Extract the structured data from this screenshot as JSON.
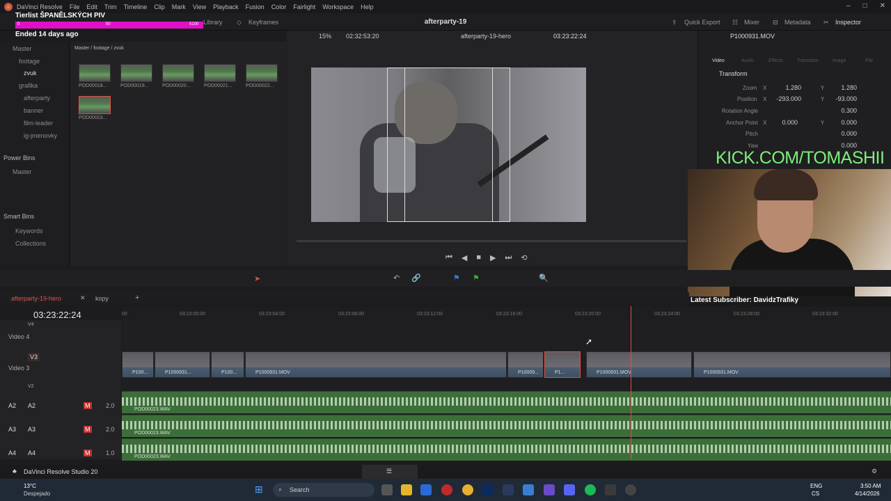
{
  "menu": {
    "app": "DaVinci Resolve",
    "items": [
      "File",
      "Edit",
      "Trim",
      "Timeline",
      "Clip",
      "Mark",
      "View",
      "Playback",
      "Fusion",
      "Color",
      "Fairlight",
      "Workspace",
      "Help"
    ]
  },
  "overlay": {
    "tierlist": "Tierlist ŠPANĚLSKÝCH PIV",
    "bar_left": "0",
    "bar_mid": "50",
    "bar_right": "5100",
    "ended": "Ended 14 days ago"
  },
  "toolbar": {
    "library": "Library",
    "keyframes": "Keyframes",
    "project_title": "afterparty-19",
    "quick_export": "Quick Export",
    "mixer": "Mixer",
    "metadata": "Metadata",
    "inspector": "Inspector"
  },
  "viewer": {
    "zoom": "15%",
    "timecode_left": "02:32:53:20",
    "timeline_name": "afterparty-19-hero",
    "timecode_right": "03:23:22:24"
  },
  "media": {
    "path": "Master / footage / zvuk",
    "thumbs": [
      "POD00018...",
      "POD00019...",
      "POD00020...",
      "POD00021...",
      "POD00022...",
      "POD00023..."
    ]
  },
  "bins": {
    "master": "Master",
    "footage": "footage",
    "zvuk": "zvuk",
    "grafika": "grafika",
    "afterparty": "afterparty",
    "banner": "banner",
    "film_leader": "film-leader",
    "ig": "ig-jmenovky",
    "power_bins": "Power Bins",
    "pb_master": "Master",
    "smart_bins": "Smart Bins",
    "keywords": "Keywords",
    "collections": "Collections"
  },
  "inspector": {
    "clip": "P1000931.MOV",
    "tab_video": "Video",
    "tab_audio": "Audio",
    "tab_effects": "Effects",
    "tab_transition": "Transition",
    "tab_image": "Image",
    "tab_file": "File",
    "transform": "Transform",
    "zoom_label": "Zoom",
    "zoom_x": "1.280",
    "zoom_y": "1.280",
    "position_label": "Position",
    "pos_x": "-293.000",
    "pos_y": "-93.000",
    "rotation_label": "Rotation Angle",
    "rotation": "0.300",
    "anchor_label": "Anchor Point",
    "anchor_x": "0.000",
    "anchor_y": "0.000",
    "pitch_label": "Pitch",
    "pitch": "0.000",
    "yaw_label": "Yaw",
    "yaw": "0.000",
    "x": "X",
    "y": "Y"
  },
  "stream": {
    "kick": "KICK.COM/TOMASHII",
    "subscriber": "Latest Subscriber: DavidzTrafiky"
  },
  "timeline": {
    "tab1": "afterparty-19-hero",
    "tab2": "kopy",
    "timecode": "03:23:22:24",
    "ticks": [
      "00",
      "03:23:00:00",
      "03:23:04:00",
      "03:23:08:00",
      "03:23:12:00",
      "03:23:16:00",
      "03:23:20:00",
      "03:23:24:00",
      "03:23:28:00",
      "03:23:32:00"
    ]
  },
  "tracks": {
    "v4": "Video 4",
    "v3": "Video 3",
    "v3_tag": "V3",
    "v2_tag": "V2",
    "v4_tag": "V4",
    "a2": "A2",
    "a3": "A3",
    "a4": "A4",
    "a2_lvl": "2.0",
    "a3_lvl": "2.0",
    "a4_lvl": "1.0",
    "clips": [
      "P100...",
      "P1000931...",
      "P100...",
      "P1000931.MOV",
      "P10009...",
      "P1...",
      "P1000931.MOV",
      "P1000931.MOV"
    ],
    "audio_clip": "POD00023.WAV"
  },
  "footer": {
    "app_name": "DaVinci Resolve Studio 20"
  },
  "taskbar": {
    "temp": "13°C",
    "weather": "Despejado",
    "search": "Search",
    "lang": "ENG",
    "lang2": "CS",
    "time": "3:50 AM",
    "date": "4/14/2026"
  }
}
